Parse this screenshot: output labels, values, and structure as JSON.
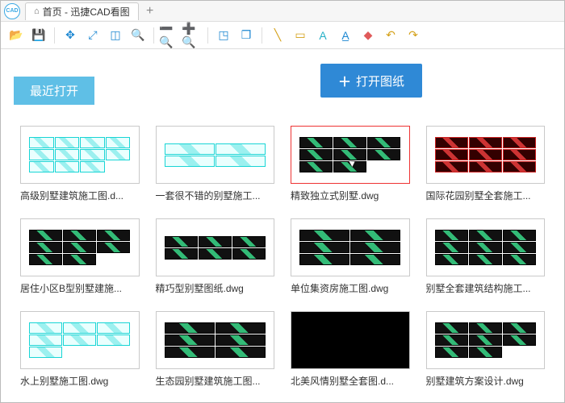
{
  "tab": {
    "title": "首页 - 迅捷CAD看图"
  },
  "open_button": {
    "label": "打开图纸"
  },
  "recent_label": "最近打开",
  "files": [
    {
      "name": "高级别墅建筑施工图.d...",
      "style": "cyan",
      "cols": "c4",
      "count": 11,
      "selected": false,
      "dark": false
    },
    {
      "name": "一套很不错的别墅施工...",
      "style": "cyan",
      "cols": "c2",
      "count": 4,
      "selected": false,
      "dark": false
    },
    {
      "name": "精致独立式别墅.dwg",
      "style": "black",
      "cols": "c3",
      "count": 8,
      "selected": true,
      "dark": false
    },
    {
      "name": "国际花园别墅全套施工...",
      "style": "red",
      "cols": "c3",
      "count": 9,
      "selected": false,
      "dark": false
    },
    {
      "name": "居住小区B型别墅建施...",
      "style": "black",
      "cols": "c3",
      "count": 8,
      "selected": false,
      "dark": false
    },
    {
      "name": "精巧型别墅图纸.dwg",
      "style": "black",
      "cols": "c3",
      "count": 6,
      "selected": false,
      "dark": false
    },
    {
      "name": "单位集资房施工图.dwg",
      "style": "black",
      "cols": "c2",
      "count": 6,
      "selected": false,
      "dark": false
    },
    {
      "name": "别墅全套建筑结构施工...",
      "style": "black",
      "cols": "c3",
      "count": 9,
      "selected": false,
      "dark": false
    },
    {
      "name": "水上别墅施工图.dwg",
      "style": "cyan",
      "cols": "c3",
      "count": 7,
      "selected": false,
      "dark": false
    },
    {
      "name": "生态园别墅建筑施工图...",
      "style": "black",
      "cols": "c2",
      "count": 6,
      "selected": false,
      "dark": false
    },
    {
      "name": "北美风情别墅全套图.d...",
      "style": "black",
      "cols": "c3",
      "count": 0,
      "selected": false,
      "dark": true
    },
    {
      "name": "别墅建筑方案设计.dwg",
      "style": "black",
      "cols": "c3",
      "count": 8,
      "selected": false,
      "dark": false
    }
  ],
  "toolbar_icons": [
    "open-folder-icon",
    "save-icon",
    "move-icon",
    "zoom-fit-icon",
    "zoom-window-icon",
    "search-icon",
    "zoom-out-icon",
    "zoom-in-icon",
    "box-3d-icon",
    "cube-icon",
    "line-icon",
    "rect-icon",
    "text-icon",
    "dimension-icon",
    "eraser-icon",
    "undo-icon",
    "redo-icon"
  ]
}
